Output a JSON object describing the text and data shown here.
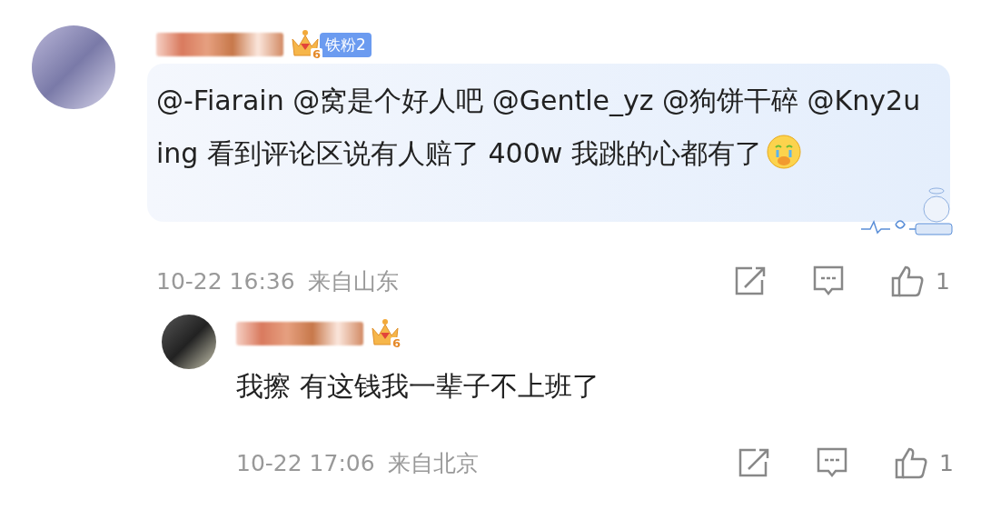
{
  "comments": [
    {
      "fan_badge": {
        "crown_level": "6",
        "label": "铁粉2"
      },
      "text": "@-Fiarain @窝是个好人吧 @Gentle_yz @狗饼干碎 @Kny2uing 看到评论区说有人赔了 400w 我跳的心都有了",
      "emoji": true,
      "time": "10-22 16:36",
      "location": "来自山东",
      "likes": "1",
      "bubble": true
    },
    {
      "fan_badge": {
        "crown_level": "6"
      },
      "text": "我擦 有这钱我一辈子不上班了",
      "emoji": false,
      "time": "10-22 17:06",
      "location": "来自北京",
      "likes": "1",
      "bubble": false
    }
  ]
}
